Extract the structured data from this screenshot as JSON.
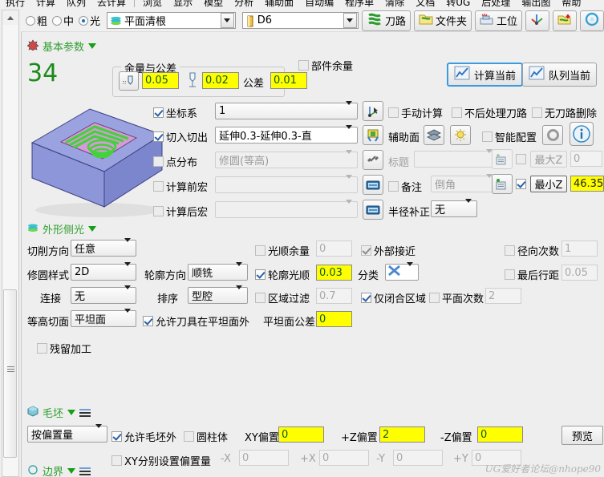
{
  "menubar": {
    "items": [
      "执行",
      "计算",
      "队列",
      "去计算",
      "浏览",
      "显示",
      "模型",
      "分析",
      "辅助面",
      "自动编",
      "程序单",
      "清除",
      "文档",
      "转UG",
      "后处理",
      "输出图",
      "帮助"
    ],
    "separator_after_index": 3
  },
  "toolbar": {
    "radios": [
      {
        "label": "粗",
        "checked": false
      },
      {
        "label": "中",
        "checked": false
      },
      {
        "label": "光",
        "checked": true
      }
    ],
    "operation_combo": {
      "value": "平面清根",
      "icon": "layers-icon"
    },
    "tool_combo": {
      "value": "D6",
      "icon": "tool-icon"
    },
    "buttons": [
      {
        "label": "刀路",
        "icon": "toolpath-icon"
      },
      {
        "label": "文件夹",
        "icon": "folder-icon"
      },
      {
        "label": "工位",
        "icon": "station-icon"
      },
      {
        "label": "",
        "icon": "axis-icon"
      },
      {
        "label": "",
        "icon": "toolpath-add-icon"
      },
      {
        "label": "",
        "icon": "circle-icon"
      }
    ]
  },
  "basic": {
    "title": "基本参数",
    "index_number": "34",
    "stock_group_legend": "余量与公差",
    "side_stock": "0.05",
    "floor_stock": "0.02",
    "tolerance_label": "公差",
    "tolerance": "0.01",
    "part_stock": {
      "label": "部件余量",
      "checked": false
    },
    "calc_current": "计算当前",
    "queue_current": "队列当前",
    "coord_system": {
      "label": "坐标系",
      "checked": true,
      "value": "1"
    },
    "lead_in_out": {
      "label": "切入切出",
      "checked": true,
      "value": "延伸0.3-延伸0.3-直"
    },
    "point_dist": {
      "label": "点分布",
      "checked": false,
      "value": "修圆(等高)"
    },
    "macro_before": {
      "label": "计算前宏",
      "checked": false,
      "value": ""
    },
    "macro_after": {
      "label": "计算后宏",
      "checked": false,
      "value": ""
    },
    "manual_calc": {
      "label": "手动计算",
      "checked": false
    },
    "no_post": {
      "label": "不后处理刀路",
      "checked": false
    },
    "no_path_delete": {
      "label": "无刀路删除",
      "checked": false
    },
    "aux_surface": "辅助面",
    "smart_config": {
      "label": "智能配置",
      "checked": false
    },
    "title_field": {
      "label": "标题",
      "value": ""
    },
    "remark": {
      "label": "备注",
      "checked": false,
      "value": "倒角"
    },
    "radius_comp": {
      "label": "半径补正",
      "value": "无"
    },
    "max_z": {
      "label": "最大Z",
      "checked": false,
      "value": "0"
    },
    "min_z": {
      "label": "最小Z",
      "checked": true,
      "value": "46.35"
    }
  },
  "profile": {
    "title": "外形侧光",
    "cut_direction": {
      "label": "切削方向",
      "value": "任意"
    },
    "round_style": {
      "label": "修圆样式",
      "value": "2D"
    },
    "contour_direction": {
      "label": "轮廓方向",
      "value": "顺铣"
    },
    "connect": {
      "label": "连接",
      "value": "无"
    },
    "sort": {
      "label": "排序",
      "value": "型腔"
    },
    "contour_surface": {
      "label": "等高切面",
      "value": "平坦面"
    },
    "allow_outside": {
      "label": "允许刀具在平坦面外",
      "checked": true
    },
    "smooth_stock": {
      "label": "光顺余量",
      "checked": false,
      "value": "0"
    },
    "contour_smooth": {
      "label": "轮廓光顺",
      "checked": true,
      "value": "0.03"
    },
    "classify": {
      "label": "分类",
      "icon": "classify-icon"
    },
    "area_filter": {
      "label": "区域过滤",
      "checked": false,
      "value": "0.7"
    },
    "flat_tolerance": {
      "label": "平坦面公差",
      "value": "0"
    },
    "outer_approach": {
      "label": "外部接近",
      "checked": true
    },
    "closed_only": {
      "label": "仅闭合区域",
      "checked": true
    },
    "flat_count": {
      "label": "平面次数",
      "checked": false,
      "value": "2"
    },
    "radial_count": {
      "label": "径向次数",
      "checked": false,
      "value": "1"
    },
    "last_step": {
      "label": "最后行距",
      "checked": false,
      "value": "0.05"
    },
    "rest_machining": {
      "label": "残留加工",
      "checked": false
    }
  },
  "stock": {
    "title": "毛坯",
    "mode": "按偏置量",
    "allow_outside_stock": {
      "label": "允许毛坯外",
      "checked": true
    },
    "cylinder": {
      "label": "圆柱体",
      "checked": false
    },
    "xy_offset": {
      "label": "XY偏置",
      "value": "0"
    },
    "z_plus_offset": {
      "label": "+Z偏置",
      "value": "2"
    },
    "z_minus_offset": {
      "label": "-Z偏置",
      "value": "0"
    },
    "preview": "预览",
    "xy_separate": {
      "label": "XY分别设置偏置量",
      "checked": false
    },
    "minus_x": {
      "label": "-X",
      "value": "0"
    },
    "plus_x": {
      "label": "+X",
      "value": "0"
    },
    "minus_y": {
      "label": "-Y",
      "value": "0"
    },
    "plus_y": {
      "label": "+Y",
      "value": "0"
    }
  },
  "boundary": {
    "title": "边界"
  },
  "watermark": "UG爱好者论坛@nhope90",
  "colors": {
    "group_green": "#2f9e2f",
    "highlight_yellow": "#ffff00",
    "accent_blue": "#3c9ade",
    "panel_bg": "#eeeeee"
  }
}
